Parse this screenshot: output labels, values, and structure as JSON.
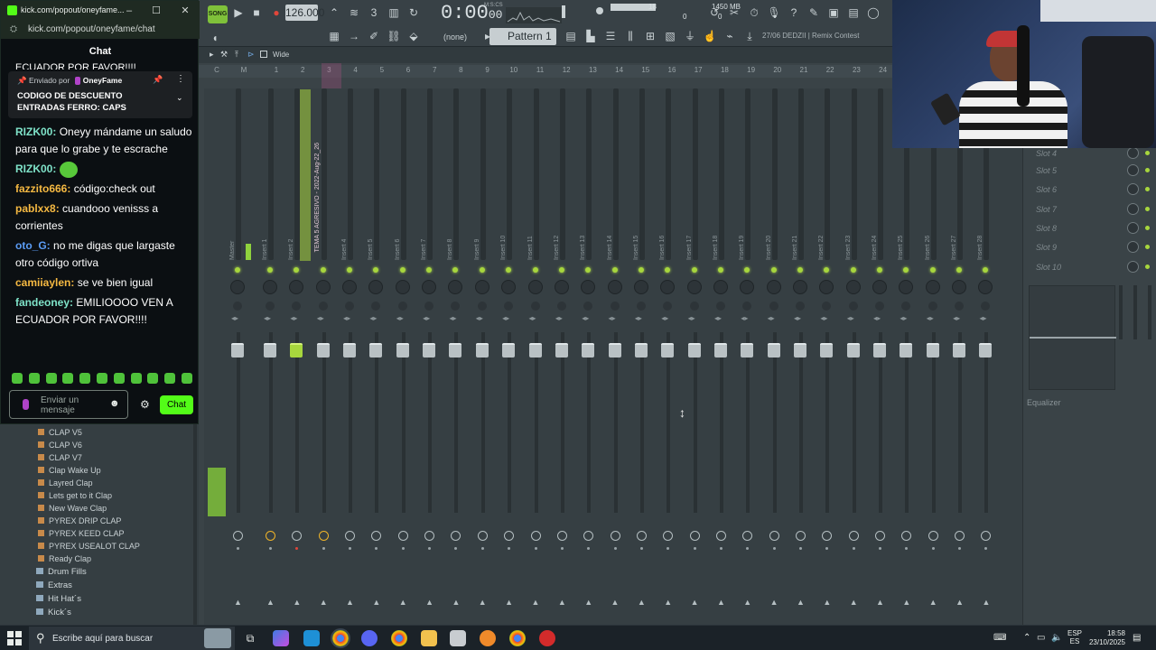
{
  "fl": {
    "song_label": "SONG",
    "tempo": "126.000",
    "time": "0:00",
    "time_sub": "00",
    "time_unit": "M:S:CS",
    "cpu": "18",
    "cpu_sub": "0",
    "ram": "1450 MB",
    "ram_sub": "0",
    "pattern_none": "(none)",
    "pattern": "Pattern 1",
    "project_info": "27/06  DEDZII | Remix Contest"
  },
  "mixer": {
    "view_mode": "Wide",
    "track_numbers": [
      "C",
      "M",
      "1",
      "2",
      "3",
      "4",
      "5",
      "6",
      "7",
      "8",
      "9",
      "10",
      "11",
      "12",
      "13",
      "14",
      "15",
      "16",
      "17",
      "18",
      "19",
      "20",
      "21",
      "22",
      "23",
      "24"
    ],
    "strips": [
      "Master",
      "Insert 1",
      "Insert 2",
      "TEMA 5 AGRESIVO - 2022-Aug-22_26",
      "Insert 4",
      "Insert 5",
      "Insert 6",
      "Insert 7",
      "Insert 8",
      "Insert 9",
      "Insert 10",
      "Insert 11",
      "Insert 12",
      "Insert 13",
      "Insert 14",
      "Insert 15",
      "Insert 16",
      "Insert 17",
      "Insert 18",
      "Insert 19",
      "Insert 20",
      "Insert 21",
      "Insert 22",
      "Insert 23",
      "Insert 24",
      "Insert 25",
      "Insert 26",
      "Insert 27",
      "Insert 28"
    ],
    "selected_track_title": "TEMA 5 AGRESIVO - 2022-Aug-22_26",
    "slots": [
      "Slot 4",
      "Slot 5",
      "Slot 6",
      "Slot 7",
      "Slot 8",
      "Slot 9",
      "Slot 10"
    ],
    "equalizer_label": "Equalizer"
  },
  "browser": {
    "items": [
      "CLAP V5",
      "CLAP V6",
      "CLAP V7",
      "Clap Wake Up",
      "Layred Clap",
      "Lets get to it Clap",
      "New Wave Clap",
      "PYREX DRIP CLAP",
      "PYREX KEED CLAP",
      "PYREX USEALOT CLAP",
      "Ready Clap"
    ],
    "folders": [
      "Drum Fills",
      "Extras",
      "Hit Hat´s",
      "Kick´s"
    ]
  },
  "chat": {
    "window_title": "kick.com/popout/oneyfame...",
    "url": "kick.com/popout/oneyfame/chat",
    "header": "Chat",
    "cut_text": "ECUADOR POR FAVOR!!!!",
    "pinned_by_prefix": "Enviado por",
    "pinned_by_user": "OneyFame",
    "pinned_text": "CODIGO DE DESCUENTO ENTRADAS FERRO: CAPS",
    "messages": [
      {
        "user": "RIZK00:",
        "text": "Oneyy mándame un saludo para que lo grabe y te escrache",
        "color": "#7fe3c9"
      },
      {
        "user": "RIZK00:",
        "text": "",
        "emote": true,
        "color": "#7fe3c9"
      },
      {
        "user": "fazzito666:",
        "text": "código:check out",
        "color": "#f5b942"
      },
      {
        "user": "pablxx8:",
        "text": "cuandooo venisss a corrientes",
        "color": "#f5b942"
      },
      {
        "user": "oto_G:",
        "text": "no me digas que largaste otro código ortiva",
        "color": "#5b9cf5"
      },
      {
        "user": "camiiaylen:",
        "text": "se ve bien igual",
        "color": "#f5b942"
      },
      {
        "user": "fandeoney:",
        "text": "EMILIOOOO VEN A ECUADOR POR FAVOR!!!!",
        "color": "#7fe3c9"
      }
    ],
    "input_placeholder": "Enviar un mensaje",
    "send_label": "Chat"
  },
  "taskbar": {
    "search_placeholder": "Escribe aquí para buscar",
    "lang_top": "ESP",
    "lang_bottom": "ES",
    "time": "18:58",
    "date": "23/10/2025"
  },
  "colors": {
    "kick_green": "#53fc18",
    "fl_led": "#a7d63d",
    "selected_track": "#aa5082"
  }
}
